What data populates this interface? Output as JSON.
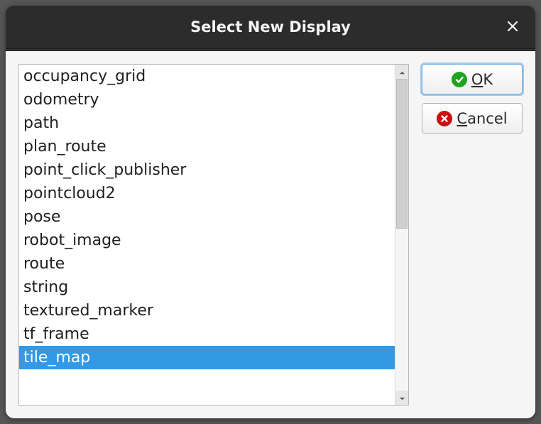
{
  "window": {
    "title": "Select New Display"
  },
  "list": {
    "items": [
      "occupancy_grid",
      "odometry",
      "path",
      "plan_route",
      "point_click_publisher",
      "pointcloud2",
      "pose",
      "robot_image",
      "route",
      "string",
      "textured_marker",
      "tf_frame",
      "tile_map"
    ],
    "selected_index": 12
  },
  "buttons": {
    "ok": {
      "mnemonic": "O",
      "rest": "K"
    },
    "cancel": {
      "mnemonic": "C",
      "rest": "ancel"
    }
  }
}
